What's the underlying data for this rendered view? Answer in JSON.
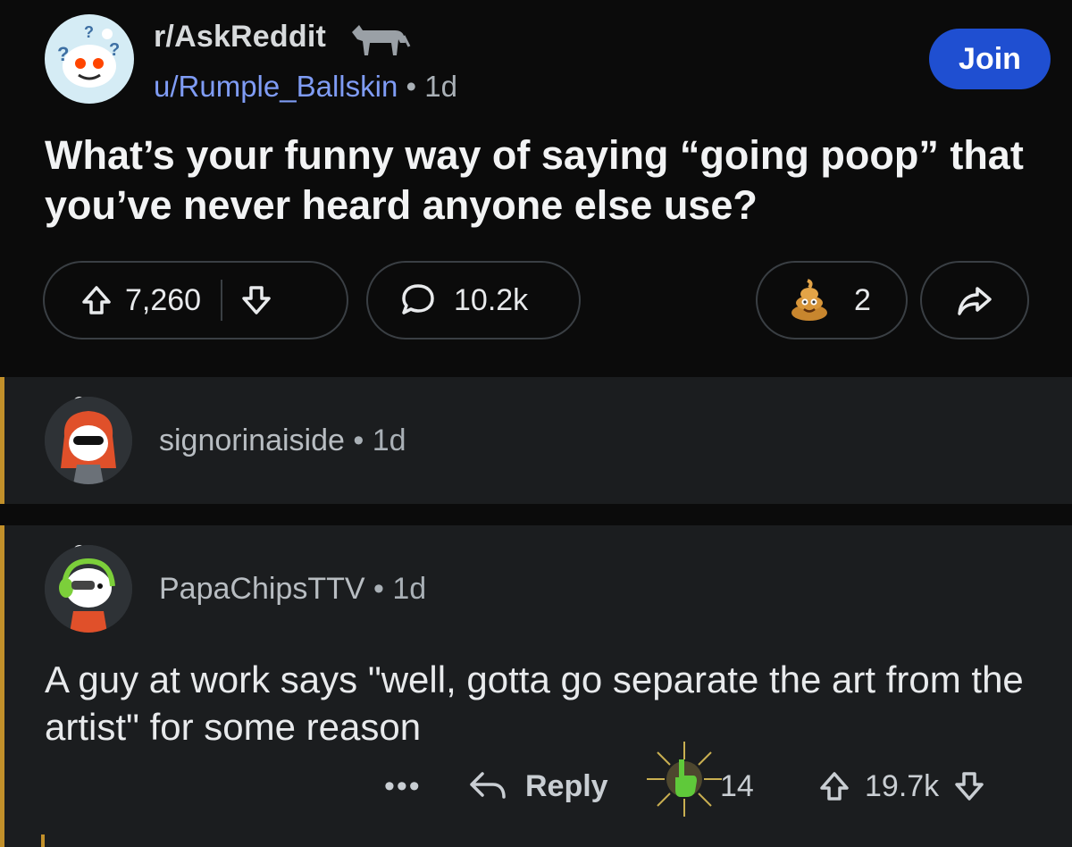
{
  "post": {
    "subreddit": "r/AskReddit",
    "username": "u/Rumple_Ballskin",
    "separator": "•",
    "age": "1d",
    "join_label": "Join",
    "title": "What’s your funny way of saying “going poop” that you’ve never heard anyone else use?",
    "upvotes": "7,260",
    "comments": "10.2k",
    "awards": "2",
    "icons": [
      "reddit-snoo-icon",
      "donkey-flair-icon",
      "upvote-icon",
      "downvote-icon",
      "comment-icon",
      "poop-award-icon",
      "share-icon"
    ]
  },
  "comments": [
    {
      "username": "signorinaiside",
      "separator": "•",
      "age": "1d",
      "collapsed": true
    },
    {
      "username": "PapaChipsTTV",
      "separator": "•",
      "age": "1d",
      "body": "A guy at work says \"well, gotta go separate the art from the artist\" for some reason",
      "more_label": "•••",
      "reply_label": "Reply",
      "award_count": "14",
      "score": "19.7k"
    }
  ],
  "colors": {
    "join": "#1f4fd1",
    "username_link": "#7f9cf5",
    "thread_bar": "#c2902a",
    "comment_bg": "#1b1d1f",
    "post_bg": "#0b0b0b"
  }
}
